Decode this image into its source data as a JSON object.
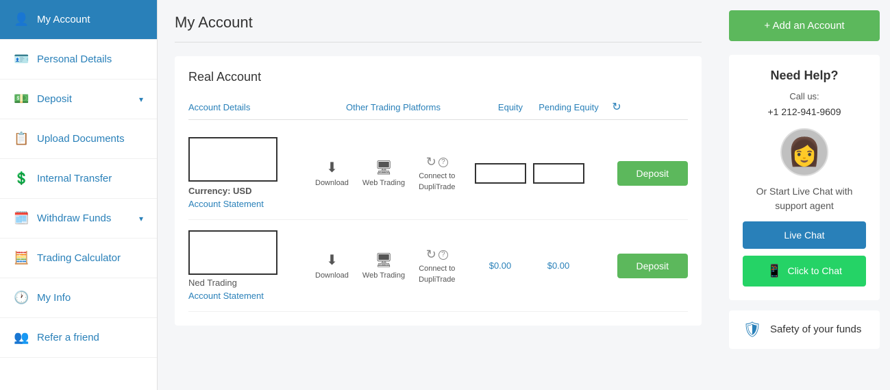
{
  "sidebar": {
    "items": [
      {
        "id": "my-account",
        "label": "My Account",
        "icon": "👤",
        "active": true
      },
      {
        "id": "personal-details",
        "label": "Personal Details",
        "icon": "🪪",
        "active": false
      },
      {
        "id": "deposit",
        "label": "Deposit",
        "icon": "💵",
        "active": false,
        "chevron": "▾"
      },
      {
        "id": "upload-documents",
        "label": "Upload Documents",
        "icon": "📋",
        "active": false
      },
      {
        "id": "internal-transfer",
        "label": "Internal Transfer",
        "icon": "💲",
        "active": false
      },
      {
        "id": "withdraw-funds",
        "label": "Withdraw Funds",
        "icon": "🗓️",
        "active": false,
        "chevron": "▾"
      },
      {
        "id": "trading-calculator",
        "label": "Trading Calculator",
        "icon": "🧮",
        "active": false
      },
      {
        "id": "my-info",
        "label": "My Info",
        "icon": "🕐",
        "active": false
      },
      {
        "id": "refer-a-friend",
        "label": "Refer a friend",
        "icon": "👥",
        "active": false
      }
    ]
  },
  "main": {
    "page_title": "My Account",
    "section_title": "Real Account",
    "table_headers": {
      "account_details": "Account Details",
      "other_trading": "Other Trading Platforms",
      "equity": "Equity",
      "pending_equity": "Pending Equity"
    },
    "accounts": [
      {
        "id": "account-1",
        "currency_label": "Currency:",
        "currency": "USD",
        "account_statement": "Account Statement",
        "equity": "",
        "pending_equity": "",
        "deposit_label": "Deposit"
      },
      {
        "id": "account-2",
        "name": "Ned Trading",
        "account_statement": "Account Statement",
        "equity": "$0.00",
        "pending_equity": "$0.00",
        "deposit_label": "Deposit"
      }
    ],
    "trading_actions": {
      "download": "Download",
      "web_trading": "Web Trading",
      "connect_to": "Connect to",
      "dupli_trade": "DupliTrade"
    }
  },
  "right_panel": {
    "add_account_label": "+ Add an Account",
    "help_title": "Need Help?",
    "call_us": "Call us:",
    "phone": "+1 212-941-9609",
    "live_chat_text": "Or Start Live Chat with support agent",
    "live_chat_btn": "Live Chat",
    "whatsapp_btn": "Click to Chat",
    "safety_text": "Safety of your funds"
  }
}
